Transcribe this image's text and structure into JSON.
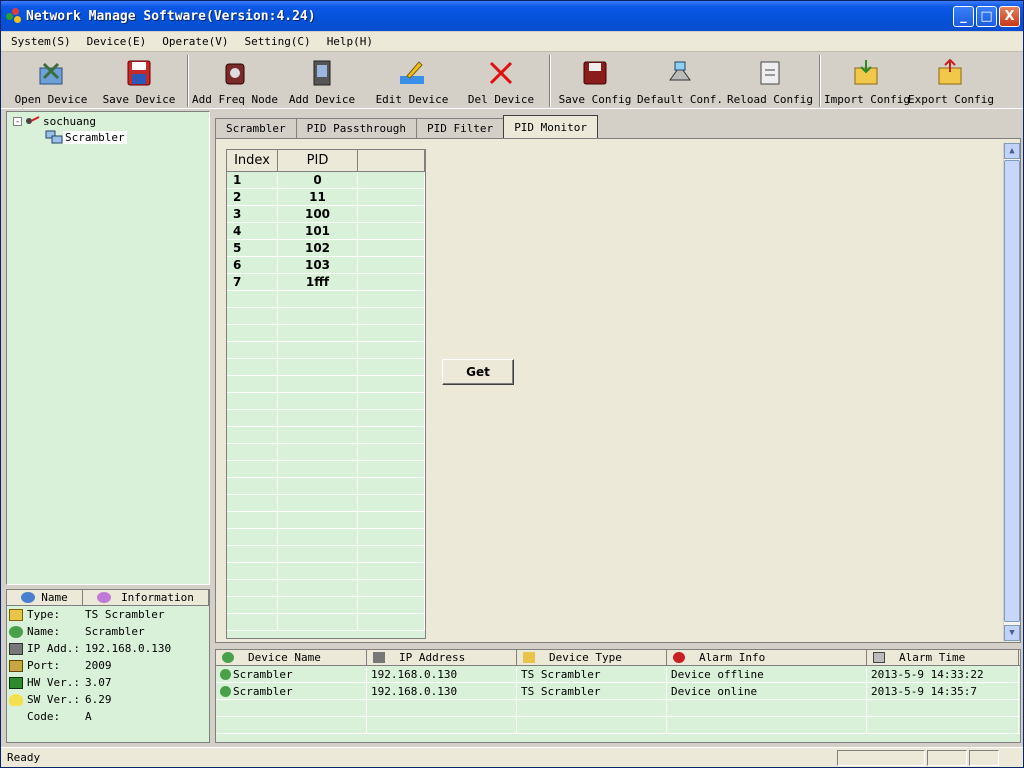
{
  "window": {
    "title": "Network Manage Software(Version:4.24)",
    "controls": {
      "minimize": "_",
      "maximize": "□",
      "close": "X"
    }
  },
  "menu": [
    "System(S)",
    "Device(E)",
    "Operate(V)",
    "Setting(C)",
    "Help(H)"
  ],
  "toolbar": [
    {
      "label": "Open Device",
      "icon": "open-device-icon"
    },
    {
      "label": "Save Device",
      "icon": "floppy-disk-icon"
    },
    {
      "label": "Add Freq Node",
      "icon": "add-freq-node-icon"
    },
    {
      "label": "Add Device",
      "icon": "add-device-icon"
    },
    {
      "label": "Edit Device",
      "icon": "edit-device-icon"
    },
    {
      "label": "Del Device",
      "icon": "red-x-icon"
    },
    {
      "label": "Save Config",
      "icon": "save-config-icon"
    },
    {
      "label": "Default Conf.",
      "icon": "default-config-icon"
    },
    {
      "label": "Reload Config",
      "icon": "reload-config-icon"
    },
    {
      "label": "Import Config",
      "icon": "import-config-icon"
    },
    {
      "label": "Export Config",
      "icon": "export-config-icon"
    }
  ],
  "tree": {
    "root": "sochuang",
    "child": "Scrambler",
    "expander": "-"
  },
  "info": {
    "headers": [
      "Name",
      "Information"
    ],
    "rows": [
      {
        "key": "Type:",
        "value": "TS Scrambler",
        "icon": "type-icon"
      },
      {
        "key": "Name:",
        "value": "Scrambler",
        "icon": "name-icon"
      },
      {
        "key": "IP Add.:",
        "value": "192.168.0.130",
        "icon": "ip-address-icon"
      },
      {
        "key": "Port:",
        "value": "2009",
        "icon": "port-icon"
      },
      {
        "key": "HW Ver.:",
        "value": "3.07",
        "icon": "hardware-icon"
      },
      {
        "key": "SW Ver.:",
        "value": "6.29",
        "icon": "bulb-icon"
      },
      {
        "key": "Code:",
        "value": "A",
        "icon": ""
      }
    ]
  },
  "tabs": [
    "Scrambler",
    "PID Passthrough",
    "PID Filter",
    "PID Monitor"
  ],
  "active_tab": "PID Monitor",
  "pid_monitor": {
    "headers": [
      "Index",
      "PID"
    ],
    "rows": [
      {
        "index": "1",
        "pid": "0"
      },
      {
        "index": "2",
        "pid": "11"
      },
      {
        "index": "3",
        "pid": "100"
      },
      {
        "index": "4",
        "pid": "101"
      },
      {
        "index": "5",
        "pid": "102"
      },
      {
        "index": "6",
        "pid": "103"
      },
      {
        "index": "7",
        "pid": "1fff"
      }
    ],
    "get_button": "Get"
  },
  "alarms": {
    "headers": [
      "Device Name",
      "IP Address",
      "Device Type",
      "Alarm Info",
      "Alarm Time"
    ],
    "rows": [
      {
        "device": "Scrambler",
        "ip": "192.168.0.130",
        "type": "TS Scrambler",
        "info": "Device offline",
        "time": "2013-5-9 14:33:22"
      },
      {
        "device": "Scrambler",
        "ip": "192.168.0.130",
        "type": "TS Scrambler",
        "info": "Device online",
        "time": "2013-5-9 14:35:7"
      }
    ]
  },
  "status": {
    "text": "Ready"
  },
  "colors": {
    "panel_green": "#d9f0d9",
    "title_blue": "#0451d8",
    "window_gray": "#d4d0c8"
  }
}
